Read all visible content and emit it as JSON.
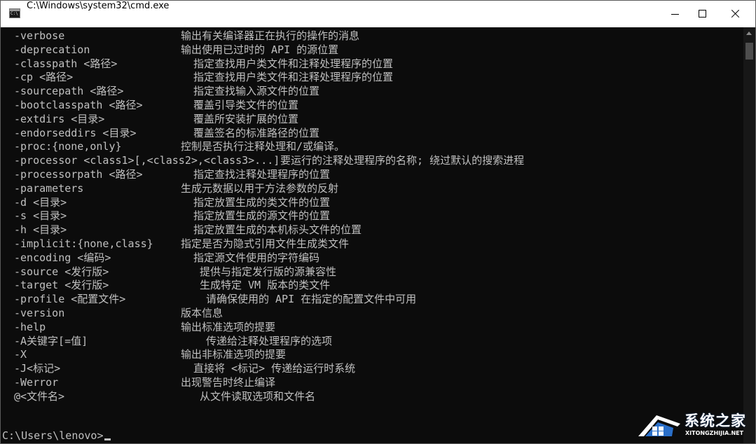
{
  "window": {
    "title": "C:\\Windows\\system32\\cmd.exe"
  },
  "console": {
    "lines": [
      {
        "opt": "-verbose",
        "desc": "输出有关编译器正在执行的操作的消息",
        "indent": 257
      },
      {
        "opt": "-deprecation",
        "desc": "输出使用已过时的 API 的源位置",
        "indent": 257
      },
      {
        "opt": "-classpath <路径>",
        "desc": "指定查找用户类文件和注释处理程序的位置",
        "indent": 275
      },
      {
        "opt": "-cp <路径>",
        "desc": "指定查找用户类文件和注释处理程序的位置",
        "indent": 275
      },
      {
        "opt": "-sourcepath <路径>",
        "desc": "指定查找输入源文件的位置",
        "indent": 275
      },
      {
        "opt": "-bootclasspath <路径>",
        "desc": "覆盖引导类文件的位置",
        "indent": 275
      },
      {
        "opt": "-extdirs <目录>",
        "desc": "覆盖所安装扩展的位置",
        "indent": 275
      },
      {
        "opt": "-endorseddirs <目录>",
        "desc": "覆盖签名的标准路径的位置",
        "indent": 275
      },
      {
        "opt": "-proc:{none,only}",
        "desc": "控制是否执行注释处理和/或编译。",
        "indent": 257
      },
      {
        "opt": "-processor <class1>[,<class2>,<class3>...]",
        "desc": "要运行的注释处理程序的名称; 绕过默认的搜索进程",
        "indent": 399
      },
      {
        "opt": "-processorpath <路径>",
        "desc": "指定查找注释处理程序的位置",
        "indent": 275
      },
      {
        "opt": "-parameters",
        "desc": "生成元数据以用于方法参数的反射",
        "indent": 257
      },
      {
        "opt": "-d <目录>",
        "desc": "指定放置生成的类文件的位置",
        "indent": 275
      },
      {
        "opt": "-s <目录>",
        "desc": "指定放置生成的源文件的位置",
        "indent": 275
      },
      {
        "opt": "-h <目录>",
        "desc": "指定放置生成的本机标头文件的位置",
        "indent": 275
      },
      {
        "opt": "-implicit:{none,class}",
        "desc": "指定是否为隐式引用文件生成类文件",
        "indent": 257
      },
      {
        "opt": "-encoding <编码>",
        "desc": "指定源文件使用的字符编码",
        "indent": 275
      },
      {
        "opt": "-source <发行版>",
        "desc": "提供与指定发行版的源兼容性",
        "indent": 284
      },
      {
        "opt": "-target <发行版>",
        "desc": "生成特定 VM 版本的类文件",
        "indent": 284
      },
      {
        "opt": "-profile <配置文件>",
        "desc": "请确保使用的 API 在指定的配置文件中可用",
        "indent": 293
      },
      {
        "opt": "-version",
        "desc": "版本信息",
        "indent": 257
      },
      {
        "opt": "-help",
        "desc": "输出标准选项的提要",
        "indent": 257
      },
      {
        "opt": "-A关键字[=值]",
        "desc": "传递给注释处理程序的选项",
        "indent": 293
      },
      {
        "opt": "-X",
        "desc": "输出非标准选项的提要",
        "indent": 257
      },
      {
        "opt": "-J<标记>",
        "desc": "直接将 <标记> 传递给运行时系统",
        "indent": 275
      },
      {
        "opt": "-Werror",
        "desc": "出现警告时终止编译",
        "indent": 257
      },
      {
        "opt": "@<文件名>",
        "desc": "从文件读取选项和文件名",
        "indent": 284
      }
    ],
    "prompt": "C:\\Users\\lenovo>"
  },
  "watermark": {
    "name": "系统之家",
    "url": "XITONGZHIJIA.NET"
  },
  "colors": {
    "background": "#0c0c0c",
    "text": "#c0c0c0",
    "titlebar": "#ffffff"
  }
}
